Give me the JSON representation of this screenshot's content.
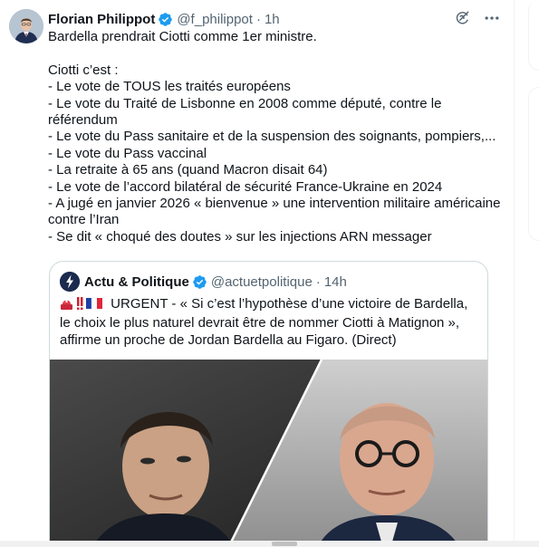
{
  "tweet": {
    "author_name": "Florian Philippot",
    "handle": "@f_philippot",
    "separator": "·",
    "time": "1h",
    "lines": [
      "Bardella prendrait Ciotti comme 1er ministre.",
      "",
      "Ciotti c’est :",
      "- Le vote de TOUS les traités européens",
      "- Le vote du Traité de Lisbonne en 2008 comme député, contre le",
      "référendum",
      "- Le vote du Pass sanitaire et de la suspension des soignants, pompiers,...",
      "- Le vote du Pass vaccinal",
      "- La retraite à 65 ans (quand Macron disait 64)",
      "- Le vote de l’accord bilatéral de sécurité France-Ukraine en 2024",
      "- A jugé en janvier 2026 « bienvenue » une intervention militaire américaine",
      "contre l’Iran",
      "- Se dit « choqué des doutes » sur les injections ARN messager"
    ]
  },
  "quote": {
    "author_name": "Actu & Politique",
    "handle": "@actuetpolitique",
    "separator": "·",
    "time": "14h",
    "emoji_prefix": "🚨‼️🇫🇷",
    "text": "URGENT - « Si c’est l’hypothèse d’une victoire de Bardella, le choix le plus naturel devrait être de nommer Ciotti à Matignon », affirme un proche de Jordan Bardella au Figaro. (Direct)"
  },
  "colors": {
    "verified_blue": "#1d9bf0",
    "secondary_text": "#536471",
    "border": "#cfd9de"
  },
  "icons": {
    "verified": "verified-badge-icon",
    "grok": "grok-icon",
    "more": "more-options-icon"
  }
}
